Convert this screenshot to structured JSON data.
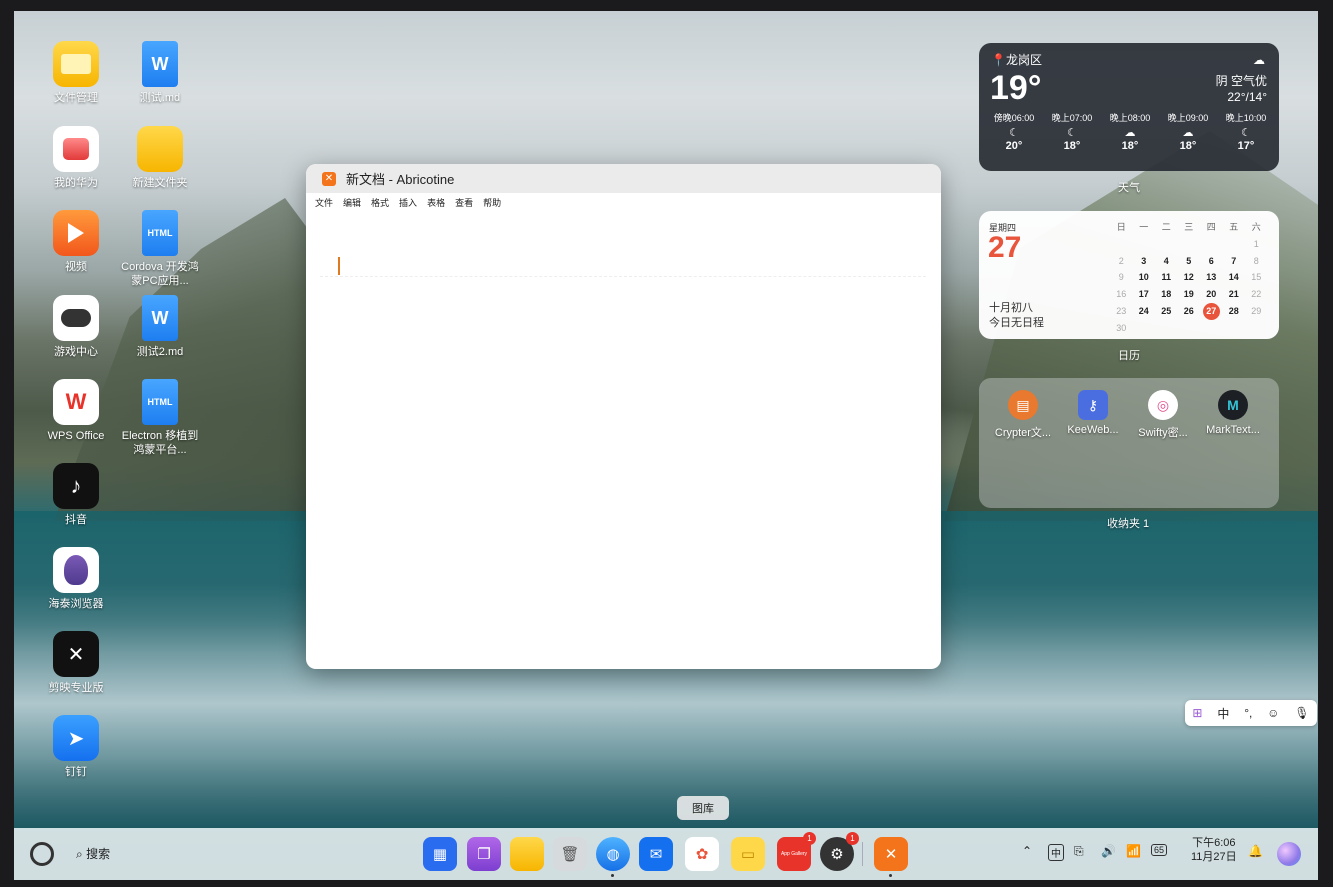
{
  "desktop": {
    "icons": [
      {
        "label": "文件管理",
        "icon": "folder-icon"
      },
      {
        "label": "测试.md",
        "icon": "word-doc-icon",
        "badge": "W"
      },
      {
        "label": "我的华为",
        "icon": "huawei-icon"
      },
      {
        "label": "新建文件夹",
        "icon": "folder-icon"
      },
      {
        "label": "视频",
        "icon": "video-icon"
      },
      {
        "label": "Cordova 开发鸿蒙PC应用...",
        "icon": "html-file-icon",
        "badge": "HTML"
      },
      {
        "label": "游戏中心",
        "icon": "gamepad-icon"
      },
      {
        "label": "测试2.md",
        "icon": "word-doc-icon",
        "badge": "W"
      },
      {
        "label": "WPS Office",
        "icon": "wps-icon"
      },
      {
        "label": "Electron 移植到鸿蒙平台...",
        "icon": "html-file-icon",
        "badge": "HTML"
      },
      {
        "label": "抖音",
        "icon": "douyin-icon"
      },
      {
        "label": "海泰浏览器",
        "icon": "browser-icon"
      },
      {
        "label": "剪映专业版",
        "icon": "capcut-icon"
      },
      {
        "label": "钉钉",
        "icon": "dingtalk-icon"
      }
    ]
  },
  "window": {
    "title": "新文档 - Abricotine",
    "menu": [
      "文件",
      "编辑",
      "格式",
      "插入",
      "表格",
      "查看",
      "帮助"
    ]
  },
  "weather": {
    "location": "龙岗区",
    "temp": "19°",
    "condition": "阴  空气优",
    "range": "22°/14°",
    "hours": [
      {
        "time": "傍晚06:00",
        "temp": "20°",
        "icon": "moon-cloud-icon"
      },
      {
        "time": "晚上07:00",
        "temp": "18°",
        "icon": "moon-cloud-icon"
      },
      {
        "time": "晚上08:00",
        "temp": "18°",
        "icon": "cloud-icon"
      },
      {
        "time": "晚上09:00",
        "temp": "18°",
        "icon": "cloud-icon"
      },
      {
        "time": "晚上10:00",
        "temp": "17°",
        "icon": "moon-cloud-icon"
      }
    ],
    "label": "天气"
  },
  "calendar": {
    "weekday": "星期四",
    "day": "27",
    "lunar": "十月初八",
    "events": "今日无日程",
    "headers": [
      "日",
      "一",
      "二",
      "三",
      "四",
      "五",
      "六"
    ],
    "label": "日历",
    "cells": [
      {
        "d": "",
        "c": ""
      },
      {
        "d": "",
        "c": ""
      },
      {
        "d": "",
        "c": ""
      },
      {
        "d": "",
        "c": ""
      },
      {
        "d": "",
        "c": ""
      },
      {
        "d": "",
        "c": ""
      },
      {
        "d": "1",
        "c": "dim"
      },
      {
        "d": "2",
        "c": "dim"
      },
      {
        "d": "3",
        "c": ""
      },
      {
        "d": "4",
        "c": ""
      },
      {
        "d": "5",
        "c": ""
      },
      {
        "d": "6",
        "c": ""
      },
      {
        "d": "7",
        "c": ""
      },
      {
        "d": "8",
        "c": "dim"
      },
      {
        "d": "9",
        "c": "dim"
      },
      {
        "d": "10",
        "c": ""
      },
      {
        "d": "11",
        "c": ""
      },
      {
        "d": "12",
        "c": ""
      },
      {
        "d": "13",
        "c": ""
      },
      {
        "d": "14",
        "c": ""
      },
      {
        "d": "15",
        "c": "dim"
      },
      {
        "d": "16",
        "c": "dim"
      },
      {
        "d": "17",
        "c": ""
      },
      {
        "d": "18",
        "c": ""
      },
      {
        "d": "19",
        "c": ""
      },
      {
        "d": "20",
        "c": ""
      },
      {
        "d": "21",
        "c": ""
      },
      {
        "d": "22",
        "c": "dim"
      },
      {
        "d": "23",
        "c": "dim"
      },
      {
        "d": "24",
        "c": ""
      },
      {
        "d": "25",
        "c": ""
      },
      {
        "d": "26",
        "c": ""
      },
      {
        "d": "27",
        "c": "today"
      },
      {
        "d": "28",
        "c": ""
      },
      {
        "d": "29",
        "c": "dim"
      },
      {
        "d": "30",
        "c": "dim"
      }
    ]
  },
  "folder": {
    "label": "收纳夹 1",
    "apps": [
      {
        "label": "Crypter文...",
        "icon": "crypter-icon"
      },
      {
        "label": "KeeWeb...",
        "icon": "keeweb-icon"
      },
      {
        "label": "Swifty密...",
        "icon": "swifty-icon"
      },
      {
        "label": "MarkText...",
        "icon": "marktext-icon"
      }
    ]
  },
  "ime": {
    "lang": "中",
    "punct": "°,"
  },
  "tooltip": "图库",
  "taskbar": {
    "search": "搜索",
    "time": "下午6:06",
    "date": "11月27日",
    "battery": "65",
    "ime_indicator": "中",
    "badges": {
      "appgallery": "1",
      "settings": "1"
    },
    "appgallery_text": "App Gallery"
  },
  "colors": {
    "accent": "#e8553c",
    "dock_bg": "#e1ebee",
    "weather_bg": "#282c34"
  }
}
